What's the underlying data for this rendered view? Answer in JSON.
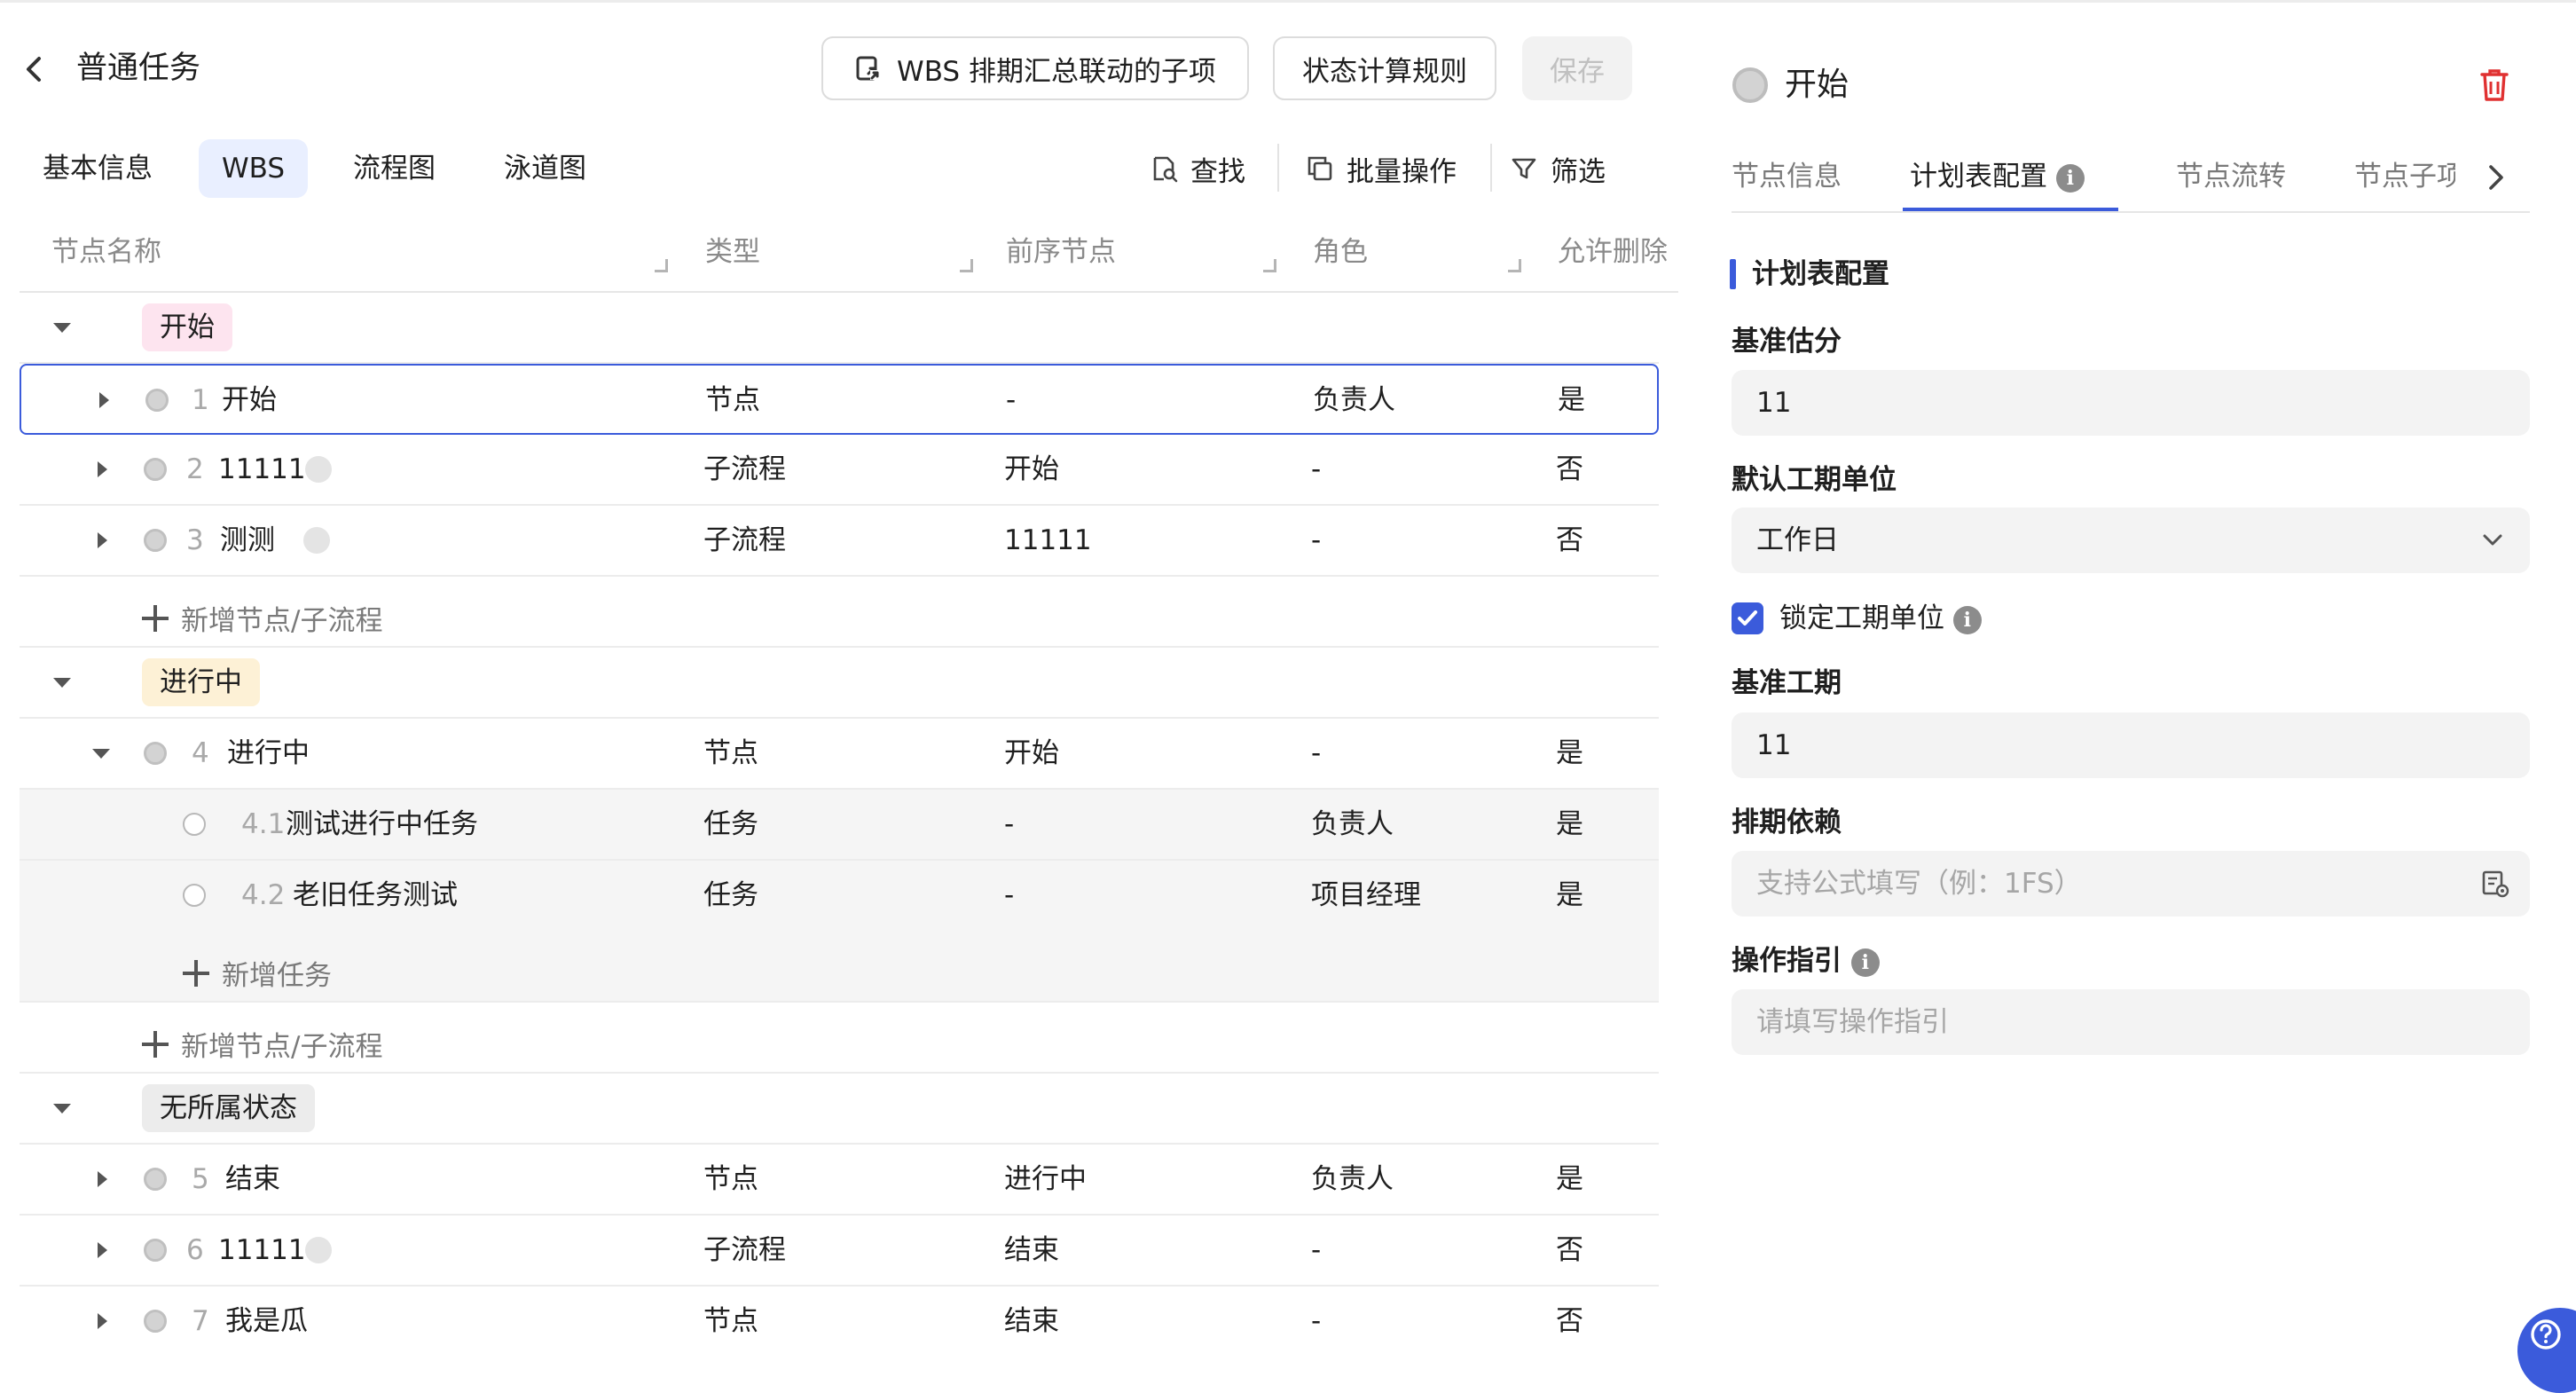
{
  "header": {
    "back_label": "",
    "title": "普通任务",
    "wbs_link_label": "WBS 排期汇总联动的子项",
    "status_rule_label": "状态计算规则",
    "save_label": "保存"
  },
  "tabs": [
    {
      "label": "基本信息"
    },
    {
      "label": "WBS",
      "active": true
    },
    {
      "label": "流程图"
    },
    {
      "label": "泳道图"
    }
  ],
  "toolbar": {
    "find_label": "查找",
    "batch_label": "批量操作",
    "filter_label": "筛选"
  },
  "table": {
    "columns": [
      "节点名称",
      "类型",
      "前序节点",
      "角色",
      "允许删除"
    ],
    "groups": [
      {
        "label": "开始",
        "color": "#fde4ef"
      },
      {
        "label": "进行中",
        "color": "#fdf1d6"
      },
      {
        "label": "无所属状态",
        "color": "#ececec"
      }
    ],
    "rows": [
      {
        "num": "1",
        "name": "开始",
        "type": "节点",
        "prev": "-",
        "role": "负责人",
        "deletable": "是"
      },
      {
        "num": "2",
        "name": "11111",
        "type": "子流程",
        "prev": "开始",
        "role": "-",
        "deletable": "否"
      },
      {
        "num": "3",
        "name": "测测",
        "type": "子流程",
        "prev": "11111",
        "role": "-",
        "deletable": "否"
      },
      {
        "num": "4",
        "name": "进行中",
        "type": "节点",
        "prev": "开始",
        "role": "-",
        "deletable": "是"
      },
      {
        "num": "4.1",
        "name": "测试进行中任务",
        "type": "任务",
        "prev": "-",
        "role": "负责人",
        "deletable": "是"
      },
      {
        "num": "4.2",
        "name": "老旧任务测试",
        "type": "任务",
        "prev": "-",
        "role": "项目经理",
        "deletable": "是"
      },
      {
        "num": "5",
        "name": "结束",
        "type": "节点",
        "prev": "进行中",
        "role": "负责人",
        "deletable": "是"
      },
      {
        "num": "6",
        "name": "11111",
        "type": "子流程",
        "prev": "结束",
        "role": "-",
        "deletable": "否"
      },
      {
        "num": "7",
        "name": "我是瓜",
        "type": "节点",
        "prev": "结束",
        "role": "-",
        "deletable": "否"
      }
    ],
    "add_node_label": "新增节点/子流程",
    "add_task_label": "新增任务"
  },
  "panel": {
    "title": "开始",
    "tabs": [
      {
        "label": "节点信息"
      },
      {
        "label": "计划表配置",
        "active": true
      },
      {
        "label": "节点流转"
      },
      {
        "label": "节点子项"
      }
    ],
    "section_title": "计划表配置",
    "baseline_score_label": "基准估分",
    "baseline_score_value": "11",
    "duration_unit_label": "默认工期单位",
    "duration_unit_value": "工作日",
    "lock_unit_label": "锁定工期单位",
    "lock_unit_checked": true,
    "baseline_duration_label": "基准工期",
    "baseline_duration_value": "11",
    "dependency_label": "排期依赖",
    "dependency_placeholder": "支持公式填写（例：1FS）",
    "guide_label": "操作指引",
    "guide_placeholder": "请填写操作指引"
  },
  "colors": {
    "accent": "#3b5bdb",
    "delete": "#e03131",
    "group_start": "#fde4ef",
    "group_progress": "#fdf1d6",
    "group_none": "#ececec"
  }
}
